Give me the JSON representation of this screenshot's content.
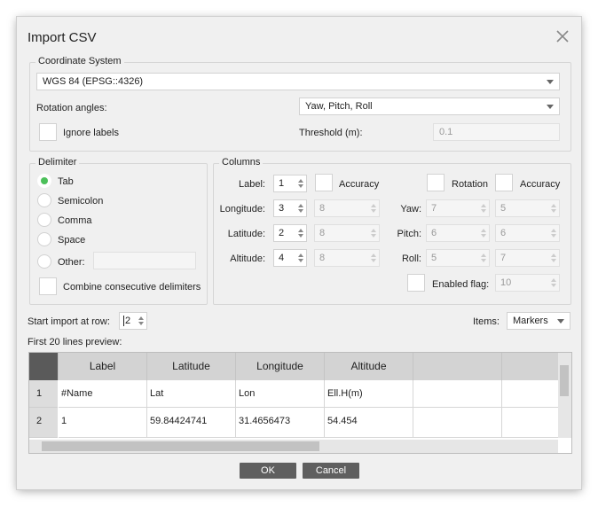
{
  "dialog": {
    "title": "Import CSV"
  },
  "coordinate_system": {
    "legend": "Coordinate System",
    "value": "WGS 84 (EPSG::4326)",
    "rotation_label": "Rotation angles:",
    "rotation_value": "Yaw, Pitch, Roll",
    "ignore_labels": "Ignore labels",
    "threshold_label": "Threshold (m):",
    "threshold_value": "0.1"
  },
  "delimiter": {
    "legend": "Delimiter",
    "options": [
      "Tab",
      "Semicolon",
      "Comma",
      "Space",
      "Other:"
    ],
    "selected": "Tab",
    "combine": "Combine consecutive delimiters"
  },
  "columns": {
    "legend": "Columns",
    "label_label": "Label:",
    "label_value": "1",
    "longitude_label": "Longitude:",
    "longitude_value": "3",
    "latitude_label": "Latitude:",
    "latitude_value": "2",
    "altitude_label": "Altitude:",
    "altitude_value": "4",
    "accuracy": "Accuracy",
    "acc_values": [
      "8",
      "8",
      "8"
    ],
    "rotation": "Rotation",
    "accuracy2": "Accuracy",
    "yaw_label": "Yaw:",
    "yaw_value": "7",
    "yaw_acc": "5",
    "pitch_label": "Pitch:",
    "pitch_value": "6",
    "pitch_acc": "6",
    "roll_label": "Roll:",
    "roll_value": "5",
    "roll_acc": "7",
    "enabled_label": "Enabled flag:",
    "enabled_value": "10"
  },
  "import": {
    "start_label": "Start import at row:",
    "start_value": "2",
    "items_label": "Items:",
    "items_value": "Markers",
    "preview_label": "First 20 lines preview:"
  },
  "preview": {
    "headers": [
      "Label",
      "Latitude",
      "Longitude",
      "Altitude",
      "",
      ""
    ],
    "rows": [
      {
        "num": "1",
        "cells": [
          "#Name",
          "Lat",
          "Lon",
          "Ell.H(m)",
          "",
          ""
        ]
      },
      {
        "num": "2",
        "cells": [
          "1",
          "59.84424741",
          "31.4656473",
          "54.454",
          "",
          ""
        ]
      }
    ]
  },
  "buttons": {
    "ok": "OK",
    "cancel": "Cancel"
  },
  "colors": {
    "radio_selected": "#4cc05a",
    "button_bg": "#5f5f5f",
    "header_bg": "#d3d3d3"
  }
}
